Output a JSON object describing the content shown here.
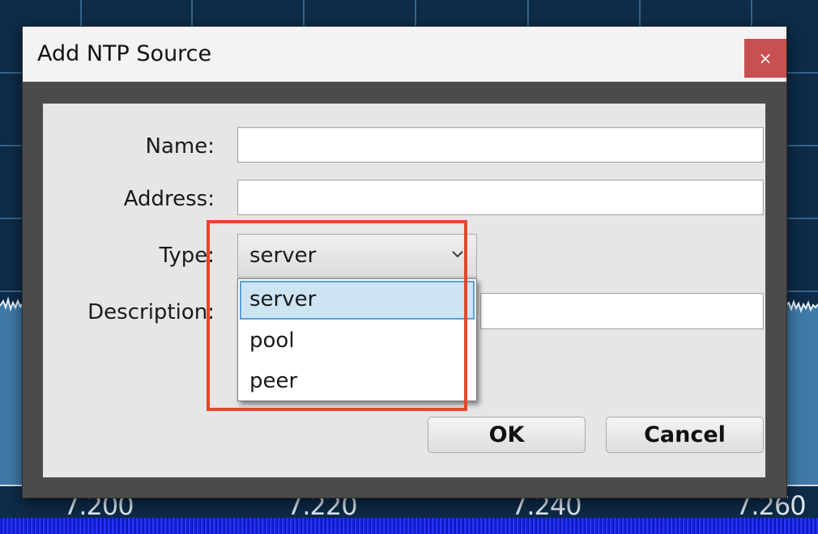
{
  "background": {
    "axis_labels": [
      "7.200",
      "7.220",
      "7.240",
      "7.260"
    ]
  },
  "dialog": {
    "title": "Add NTP Source",
    "close_glyph": "×",
    "fields": {
      "name_label": "Name:",
      "name_value": "",
      "address_label": "Address:",
      "address_value": "",
      "type_label": "Type:",
      "type_value": "server",
      "description_label": "Description:",
      "description_value": ""
    },
    "type_options": [
      "server",
      "pool",
      "peer"
    ],
    "selected_option": "server",
    "buttons": {
      "ok": "OK",
      "cancel": "Cancel"
    }
  },
  "colors": {
    "close_button": "#c75050",
    "selection": "#cde4f3",
    "highlight_box": "#e8452c"
  },
  "icons": {
    "close": "close-icon",
    "dropdown": "chevron-down-icon"
  }
}
